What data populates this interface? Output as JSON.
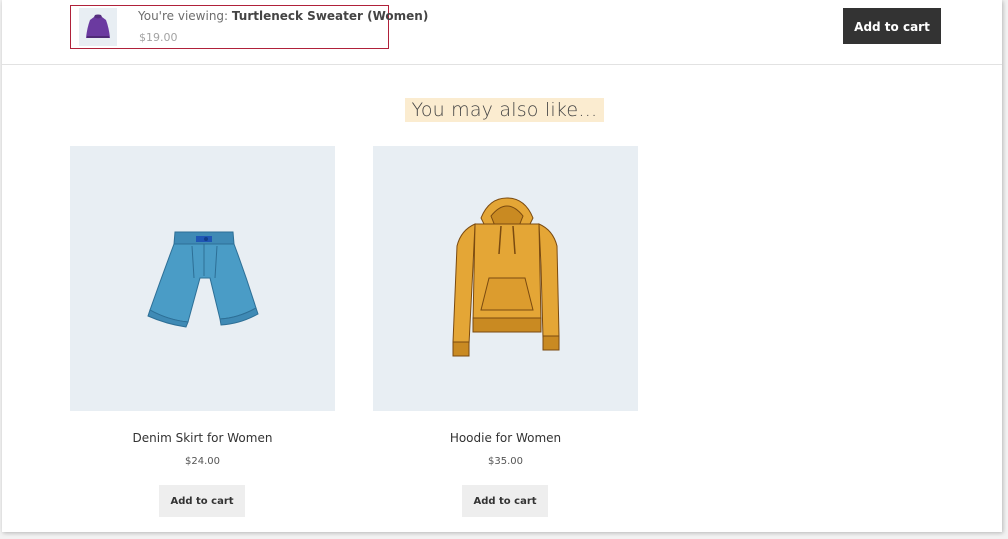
{
  "sticky_bar": {
    "viewing_prefix": "You're viewing: ",
    "product_name": "Turtleneck Sweater (Women)",
    "price": "$19.00",
    "thumbnail_icon": "purple-sweater-icon",
    "add_to_cart_label": "Add to cart"
  },
  "related": {
    "heading": "You may also like…",
    "products": [
      {
        "title": "Denim Skirt for Women",
        "price": "$24.00",
        "button_label": "Add to cart",
        "image_icon": "denim-shorts-icon",
        "color": "#4a9cc6"
      },
      {
        "title": "Hoodie for Women",
        "price": "$35.00",
        "button_label": "Add to cart",
        "image_icon": "hoodie-icon",
        "color": "#e4a636"
      }
    ]
  },
  "colors": {
    "accent_border": "#b0213a",
    "heading_highlight": "#fbecd0",
    "dark_button": "#333333",
    "image_bg": "#e8eef3"
  }
}
